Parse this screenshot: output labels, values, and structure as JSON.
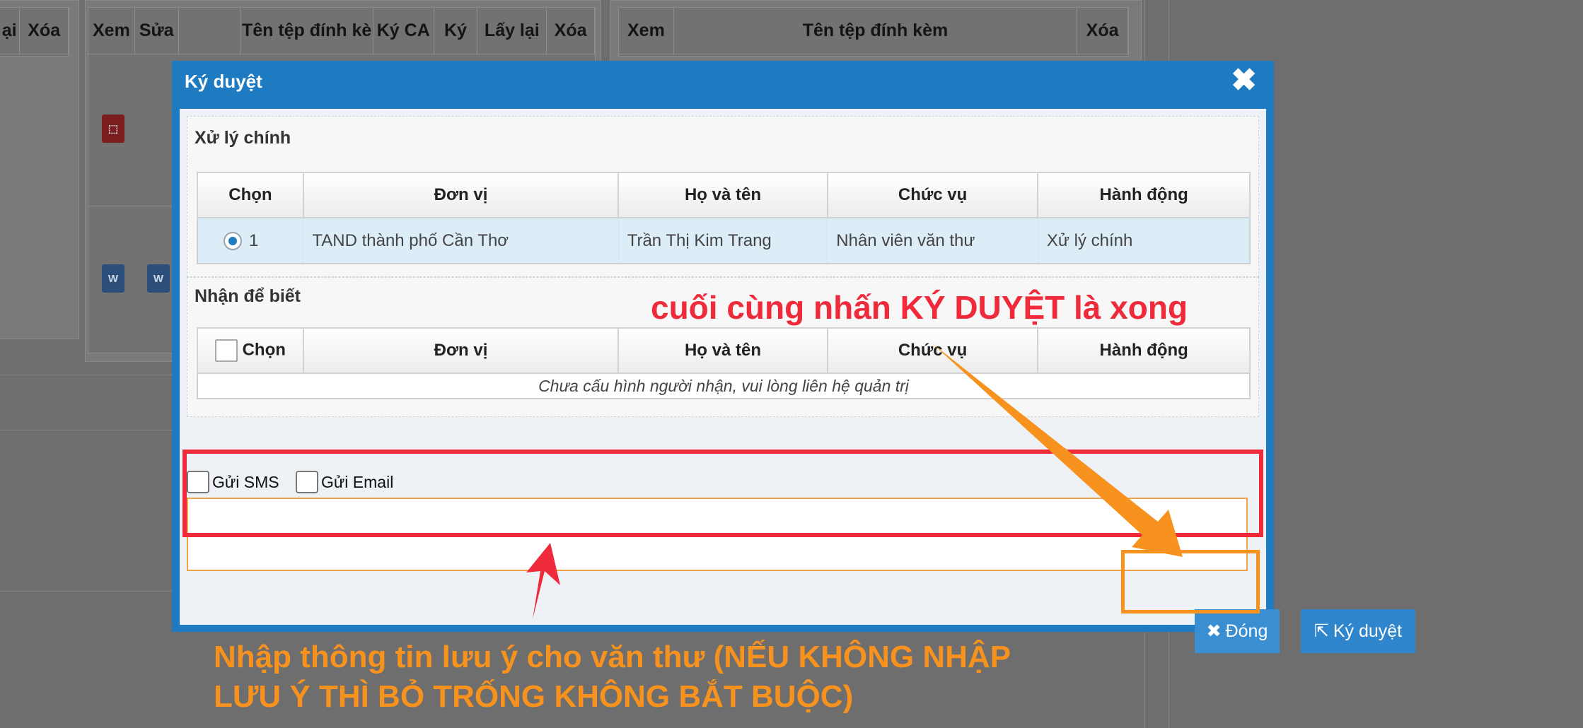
{
  "background": {
    "left_headers": [
      "ại",
      "Xóa"
    ],
    "middle_headers": [
      "Xem",
      "Sửa",
      "",
      "Tên tệp đính kè",
      "Ký CA",
      "Ký",
      "Lấy lại",
      "Xóa"
    ],
    "right_headers": [
      "Xem",
      "Tên tệp đính kèm",
      "Xóa"
    ],
    "file_icons": [
      "pdf-icon",
      "word-icon",
      "word-icon"
    ]
  },
  "modal": {
    "title": "Ký duyệt",
    "close_icon": "✖",
    "main_section": {
      "title": "Xử lý chính",
      "headers": [
        "Chọn",
        "Đơn vị",
        "Họ và tên",
        "Chức vụ",
        "Hành động"
      ],
      "rows": [
        {
          "index": "1",
          "unit": "TAND thành phố Cần Thơ",
          "name": "Trần Thị Kim Trang",
          "position": "Nhân viên văn thư",
          "action": "Xử lý chính"
        }
      ]
    },
    "notify_section": {
      "title": "Nhận để biết",
      "headers": [
        "Chọn",
        "Đơn vị",
        "Họ và tên",
        "Chức vụ",
        "Hành động"
      ],
      "empty_message": "Chưa cấu hình người nhận, vui lòng liên hệ quản trị"
    },
    "options": {
      "sms_label": "Gửi SMS",
      "email_label": "Gửi Email"
    },
    "note": {
      "value": "",
      "placeholder": ""
    },
    "buttons": {
      "close_label": "Đóng",
      "sign_label": "Ký duyệt"
    }
  },
  "annotations": {
    "top_text": "cuối cùng nhấn KÝ DUYỆT là xong",
    "bottom_text_line1": "Nhập thông tin lưu ý cho văn thư (NẾU KHÔNG NHẬP",
    "bottom_text_line2": "LƯU Ý THÌ BỎ TRỐNG KHÔNG BẮT BUỘC)",
    "colors": {
      "red": "#ef2b3b",
      "orange": "#f7921e",
      "modal_blue": "#1f7bc1"
    }
  }
}
